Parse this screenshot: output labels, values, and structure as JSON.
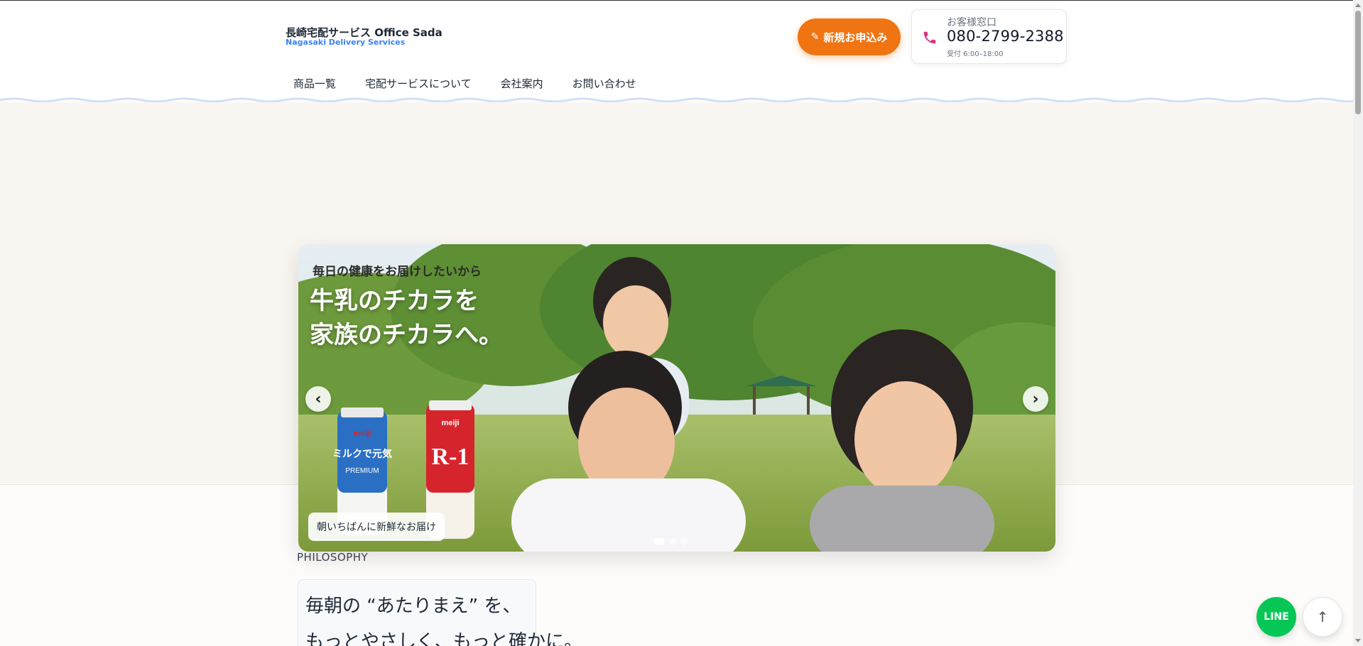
{
  "header": {
    "brand_title": "長崎宅配サービス Office Sada",
    "brand_subtitle": "Nagasaki Delivery Services",
    "apply_button": "新規お申込み",
    "contact": {
      "label": "お客様窓口",
      "phone": "080-2799-2388",
      "hours": "受付 6:00–18:00"
    },
    "nav": [
      "商品一覧",
      "宅配サービスについて",
      "会社案内",
      "お問い合わせ"
    ]
  },
  "hero": {
    "eyebrow": "毎日の健康をお届けしたいから",
    "headline_line1": "牛乳のチカラを",
    "headline_line2": "家族のチカラへ。",
    "caption": "朝いちばんに新鮮なお届け",
    "prev_label": "‹",
    "next_label": "›",
    "slide_count": 3,
    "active_slide": 1,
    "products": {
      "left_brand": "meiji",
      "left_name": "ミルクで元気",
      "left_sub": "PREMIUM",
      "right_brand": "meiji",
      "right_name": "R-1"
    }
  },
  "philosophy": {
    "label": "PHILOSOPHY",
    "line1": "毎朝の “あたりまえ” を、",
    "line2": "もっとやさしく、もっと確かに。"
  },
  "floating": {
    "line_label": "LINE",
    "top_label": "↑"
  },
  "colors": {
    "accent_orange": "#f07412",
    "brand_blue": "#3b82f6",
    "line_green": "#06c755",
    "phone_icon": "#d63384"
  },
  "icons": {
    "apply": "pencil-icon",
    "contact": "phone-icon"
  }
}
